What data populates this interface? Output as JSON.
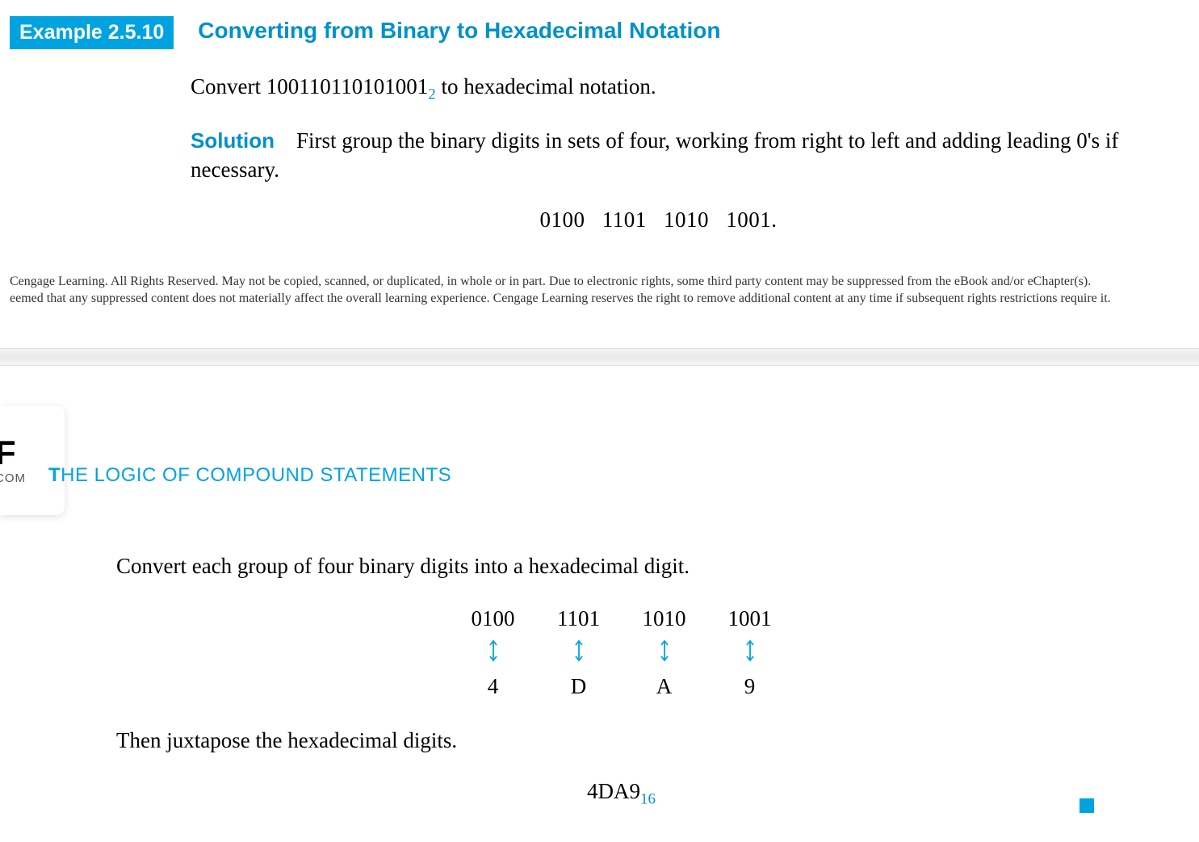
{
  "example": {
    "badge": "Example 2.5.10",
    "title": "Converting from Binary to Hexadecimal Notation",
    "problem_prefix": "Convert ",
    "problem_value": "100110110101001",
    "problem_sub": "2",
    "problem_suffix": " to hexadecimal notation.",
    "solution_label": "Solution",
    "solution_text": "First group the binary digits in sets of four, working from right to left and adding leading 0's if necessary.",
    "grouped_binary": "0100  1101  1010  1001."
  },
  "copyright": {
    "line1": "Cengage Learning. All Rights Reserved. May not be copied, scanned, or duplicated, in whole or in part. Due to electronic rights, some third party content may be suppressed from the eBook and/or eChapter(s).",
    "line2": "eemed that any suppressed content does not materially affect the overall learning experience. Cengage Learning reserves the right to remove additional content at any time if subsequent rights restrictions require it."
  },
  "watermark": {
    "big": "F",
    "small": "COM"
  },
  "chapter": {
    "num_prefix": "T",
    "num_rest": "HE LOGIC OF COMPOUND STATEMENTS"
  },
  "second": {
    "intro": "Convert each group of four binary digits into a hexadecimal digit.",
    "groups": [
      {
        "bin": "0100",
        "hex": "4"
      },
      {
        "bin": "1101",
        "hex": "D"
      },
      {
        "bin": "1010",
        "hex": "A"
      },
      {
        "bin": "1001",
        "hex": "9"
      }
    ],
    "then_text": "Then juxtapose the hexadecimal digits.",
    "result": "4DA9",
    "result_sub": "16"
  }
}
